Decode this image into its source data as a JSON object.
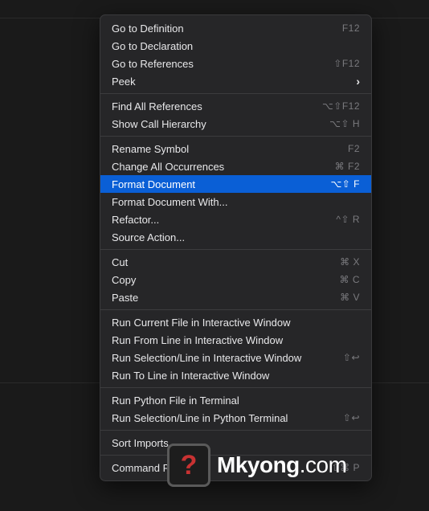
{
  "menu": {
    "groups": [
      [
        {
          "label": "Go to Definition",
          "shortcut": "F12",
          "name": "go-to-definition"
        },
        {
          "label": "Go to Declaration",
          "shortcut": "",
          "name": "go-to-declaration"
        },
        {
          "label": "Go to References",
          "shortcut": "⇧F12",
          "name": "go-to-references"
        },
        {
          "label": "Peek",
          "shortcut": "",
          "submenu": true,
          "name": "peek"
        }
      ],
      [
        {
          "label": "Find All References",
          "shortcut": "⌥⇧F12",
          "name": "find-all-references"
        },
        {
          "label": "Show Call Hierarchy",
          "shortcut": "⌥⇧ H",
          "name": "show-call-hierarchy"
        }
      ],
      [
        {
          "label": "Rename Symbol",
          "shortcut": "F2",
          "name": "rename-symbol"
        },
        {
          "label": "Change All Occurrences",
          "shortcut": "⌘ F2",
          "name": "change-all-occurrences"
        },
        {
          "label": "Format Document",
          "shortcut": "⌥⇧ F",
          "highlighted": true,
          "name": "format-document"
        },
        {
          "label": "Format Document With...",
          "shortcut": "",
          "name": "format-document-with"
        },
        {
          "label": "Refactor...",
          "shortcut": "^⇧ R",
          "name": "refactor"
        },
        {
          "label": "Source Action...",
          "shortcut": "",
          "name": "source-action"
        }
      ],
      [
        {
          "label": "Cut",
          "shortcut": "⌘ X",
          "name": "cut"
        },
        {
          "label": "Copy",
          "shortcut": "⌘ C",
          "name": "copy"
        },
        {
          "label": "Paste",
          "shortcut": "⌘ V",
          "name": "paste"
        }
      ],
      [
        {
          "label": "Run Current File in Interactive Window",
          "shortcut": "",
          "name": "run-current-file-interactive"
        },
        {
          "label": "Run From Line in Interactive Window",
          "shortcut": "",
          "name": "run-from-line-interactive"
        },
        {
          "label": "Run Selection/Line in Interactive Window",
          "shortcut": "⇧↩",
          "name": "run-selection-interactive"
        },
        {
          "label": "Run To Line in Interactive Window",
          "shortcut": "",
          "name": "run-to-line-interactive"
        }
      ],
      [
        {
          "label": "Run Python File in Terminal",
          "shortcut": "",
          "name": "run-python-file-terminal"
        },
        {
          "label": "Run Selection/Line in Python Terminal",
          "shortcut": "⇧↩",
          "name": "run-selection-python-terminal"
        }
      ],
      [
        {
          "label": "Sort Imports",
          "shortcut": "",
          "name": "sort-imports"
        }
      ],
      [
        {
          "label": "Command Palette...",
          "shortcut": "⇧⌘ P",
          "name": "command-palette"
        }
      ]
    ]
  },
  "logo": {
    "brand": "Mkyong",
    "suffix": ".com",
    "symbol": "?"
  }
}
